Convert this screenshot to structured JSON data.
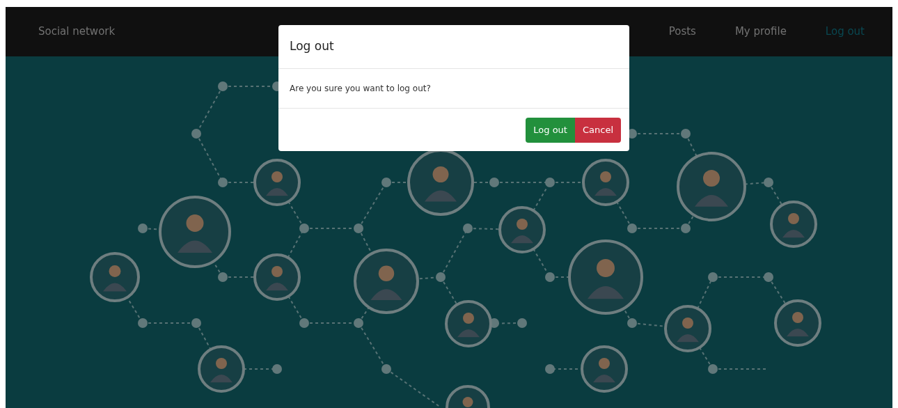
{
  "navbar": {
    "brand": "Social network",
    "items": [
      {
        "label": "Posts",
        "selected": false
      },
      {
        "label": "My profile",
        "selected": false
      },
      {
        "label": "Log out",
        "selected": true
      }
    ]
  },
  "modal": {
    "title": "Log out",
    "message": "Are you sure you want to log out?",
    "buttons": [
      {
        "label": "Log out",
        "kind": "confirm"
      },
      {
        "label": "Cancel",
        "kind": "cancel"
      }
    ]
  }
}
